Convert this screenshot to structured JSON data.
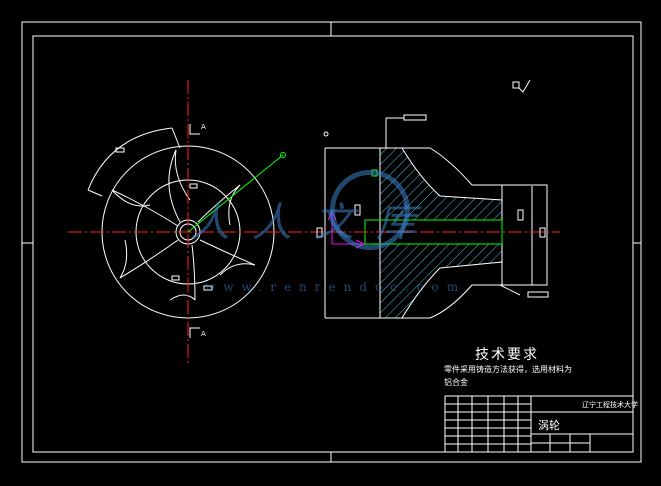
{
  "drawing": {
    "background": "#000000",
    "line_color": "#ffffff",
    "center_line_color": "#ff2020",
    "dimension_color": "#00ff00",
    "axis_color": "#ff00ff",
    "hatch_color": "#4fc3e0"
  },
  "section_labels": {
    "top_mark": "A",
    "bottom_mark": "A"
  },
  "technical_requirements": {
    "title": "技术要求",
    "line1": "零件采用铸造方法获得，选用材料为",
    "line2": "铝合金"
  },
  "title_block": {
    "school": "辽宁工程技术大学",
    "part_name": "涡轮"
  },
  "watermark": {
    "logo_text": "人人文库",
    "url": "www.renrendoc.com"
  }
}
